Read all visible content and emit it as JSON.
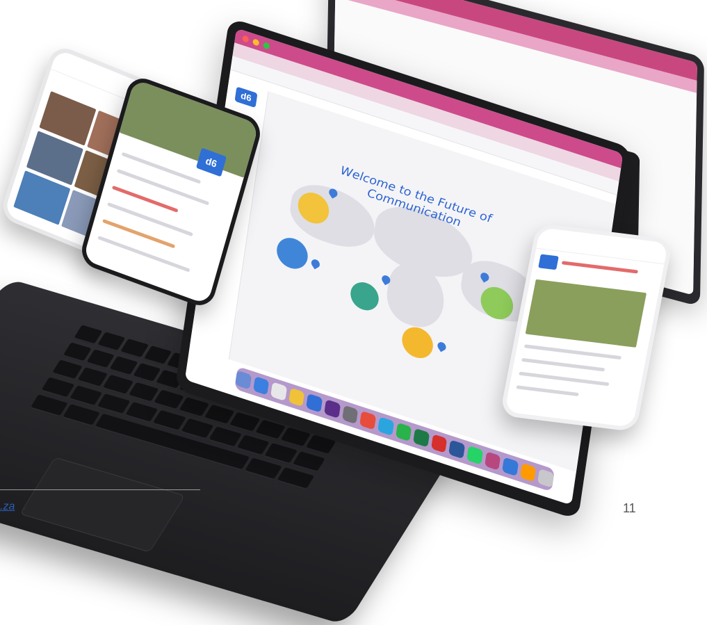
{
  "screen": {
    "welcome_line1": "Welcome to the Future of",
    "welcome_line2": "Communication",
    "app_logo": "d6"
  },
  "phones": {
    "left_near_logo": "d6"
  },
  "footer": {
    "link_fragment": ".za",
    "link_suffix": ".",
    "page_number": "11"
  },
  "colors": {
    "chrome_pink": "#cd4b8a",
    "brand_blue": "#2f6fd6",
    "dock_purple": "#7846a0",
    "link_blue": "#2b5fb8"
  }
}
